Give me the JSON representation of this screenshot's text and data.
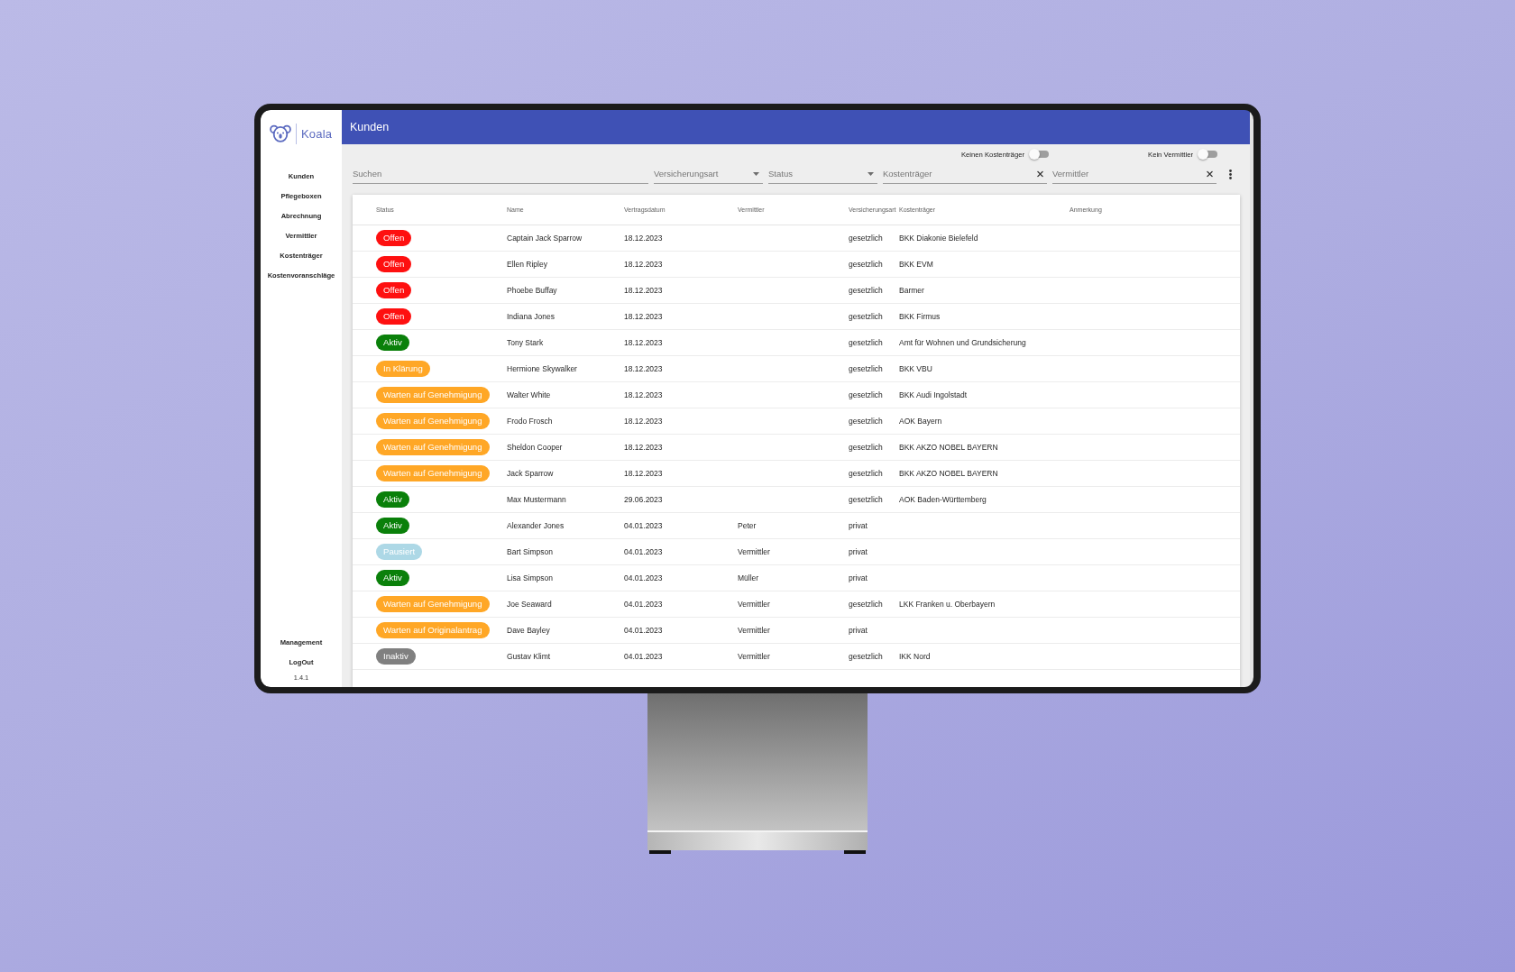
{
  "sidebar": {
    "logo": "Koala",
    "items": [
      "Kunden",
      "Pflegeboxen",
      "Abrechnung",
      "Vermittler",
      "Kostenträger",
      "Kostenvoranschläge"
    ],
    "footer_items": [
      "Management",
      "LogOut"
    ],
    "version": "1.4.1"
  },
  "header": {
    "title": "Kunden"
  },
  "toggles": [
    {
      "label": "Keinen Kostenträger",
      "on": false
    },
    {
      "label": "Kein Vermittler",
      "on": false
    }
  ],
  "filters": [
    {
      "kind": "search",
      "placeholder": "Suchen"
    },
    {
      "kind": "select",
      "placeholder": "Versicherungsart"
    },
    {
      "kind": "select",
      "placeholder": "Status"
    },
    {
      "kind": "clearable",
      "placeholder": "Kostenträger"
    },
    {
      "kind": "clearable",
      "placeholder": "Vermittler"
    }
  ],
  "table": {
    "columns": [
      "Status",
      "Name",
      "Vertragsdatum",
      "Vermittler",
      "Versicherungsart",
      "Kostenträger",
      "Anmerkung"
    ],
    "rows": [
      {
        "status": {
          "label": "Offen",
          "color": "#fe1010"
        },
        "name": "Captain Jack Sparrow",
        "vertragsdatum": "18.12.2023",
        "versicherungsart": "gesetzlich",
        "kostentraeger": "BKK Diakonie Bielefeld"
      },
      {
        "status": {
          "label": "Offen",
          "color": "#fe1010"
        },
        "name": "Ellen Ripley",
        "vertragsdatum": "18.12.2023",
        "versicherungsart": "gesetzlich",
        "kostentraeger": "BKK EVM"
      },
      {
        "status": {
          "label": "Offen",
          "color": "#fe1010"
        },
        "name": "Phoebe Buffay",
        "vertragsdatum": "18.12.2023",
        "versicherungsart": "gesetzlich",
        "kostentraeger": "Barmer"
      },
      {
        "status": {
          "label": "Offen",
          "color": "#fe1010"
        },
        "name": "Indiana Jones",
        "vertragsdatum": "18.12.2023",
        "versicherungsart": "gesetzlich",
        "kostentraeger": "BKK Firmus"
      },
      {
        "status": {
          "label": "Aktiv",
          "color": "#0a800a"
        },
        "name": "Tony Stark",
        "vertragsdatum": "18.12.2023",
        "versicherungsart": "gesetzlich",
        "kostentraeger": "Amt für Wohnen und Grundsicherung"
      },
      {
        "status": {
          "label": "In Klärung",
          "color": "#ffa726"
        },
        "name": "Hermione Skywalker",
        "vertragsdatum": "18.12.2023",
        "versicherungsart": "gesetzlich",
        "kostentraeger": "BKK VBU"
      },
      {
        "status": {
          "label": "Warten auf Genehmigung",
          "color": "#ffa726"
        },
        "name": "Walter White",
        "vertragsdatum": "18.12.2023",
        "versicherungsart": "gesetzlich",
        "kostentraeger": "BKK Audi Ingolstadt"
      },
      {
        "status": {
          "label": "Warten auf Genehmigung",
          "color": "#ffa726"
        },
        "name": "Frodo Frosch",
        "vertragsdatum": "18.12.2023",
        "versicherungsart": "gesetzlich",
        "kostentraeger": "AOK Bayern"
      },
      {
        "status": {
          "label": "Warten auf Genehmigung",
          "color": "#ffa726"
        },
        "name": "Sheldon Cooper",
        "vertragsdatum": "18.12.2023",
        "versicherungsart": "gesetzlich",
        "kostentraeger": "BKK AKZO NOBEL BAYERN"
      },
      {
        "status": {
          "label": "Warten auf Genehmigung",
          "color": "#ffa726"
        },
        "name": "Jack Sparrow",
        "vertragsdatum": "18.12.2023",
        "versicherungsart": "gesetzlich",
        "kostentraeger": "BKK AKZO NOBEL BAYERN"
      },
      {
        "status": {
          "label": "Aktiv",
          "color": "#0a800a"
        },
        "name": "Max Mustermann",
        "vertragsdatum": "29.06.2023",
        "versicherungsart": "gesetzlich",
        "kostentraeger": "AOK Baden-Württemberg"
      },
      {
        "status": {
          "label": "Aktiv",
          "color": "#0a800a"
        },
        "name": "Alexander Jones",
        "vertragsdatum": "04.01.2023",
        "vermittler": "Peter",
        "versicherungsart": "privat"
      },
      {
        "status": {
          "label": "Pausiert",
          "color": "#add8e6"
        },
        "name": "Bart Simpson",
        "vertragsdatum": "04.01.2023",
        "vermittler": "Vermittler",
        "versicherungsart": "privat"
      },
      {
        "status": {
          "label": "Aktiv",
          "color": "#0a800a"
        },
        "name": "Lisa Simpson",
        "vertragsdatum": "04.01.2023",
        "vermittler": "Müller",
        "versicherungsart": "privat"
      },
      {
        "status": {
          "label": "Warten auf Genehmigung",
          "color": "#ffa726"
        },
        "name": "Joe Seaward",
        "vertragsdatum": "04.01.2023",
        "vermittler": "Vermittler",
        "versicherungsart": "gesetzlich",
        "kostentraeger": "LKK Franken u. Oberbayern"
      },
      {
        "status": {
          "label": "Warten auf Originalantrag",
          "color": "#ffa726"
        },
        "name": "Dave Bayley",
        "vertragsdatum": "04.01.2023",
        "vermittler": "Vermittler",
        "versicherungsart": "privat"
      },
      {
        "status": {
          "label": "Inaktiv",
          "color": "#808080"
        },
        "name": "Gustav Klimt",
        "vertragsdatum": "04.01.2023",
        "vermittler": "Vermittler",
        "versicherungsart": "gesetzlich",
        "kostentraeger": "IKK Nord"
      }
    ]
  }
}
